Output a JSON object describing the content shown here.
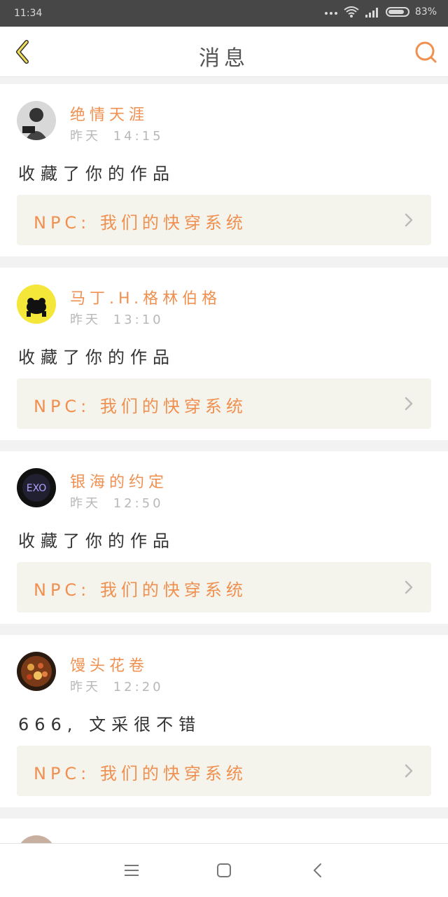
{
  "status_bar": {
    "time": "11:34",
    "battery": "83%",
    "battery_level": 0.83,
    "icons": [
      "more-dots-icon",
      "wifi-icon",
      "signal-icon",
      "battery-icon"
    ]
  },
  "app_bar": {
    "title": "消息",
    "back_icon": "back-chevron-icon",
    "search_icon": "search-icon"
  },
  "colors": {
    "accent": "#f09050",
    "card_bg": "#ffffff",
    "work_bg": "#f4f4ed",
    "page_bg": "#f2f2f2"
  },
  "messages": [
    {
      "user": "绝情天涯",
      "day": "昨天",
      "time": "14:15",
      "text": "收藏了你的作品",
      "work": "NPC: 我们的快穿系统",
      "avatar": "avatar-photo-1"
    },
    {
      "user": "马丁.H.格林伯格",
      "day": "昨天",
      "time": "13:10",
      "text": "收藏了你的作品",
      "work": "NPC: 我们的快穿系统",
      "avatar": "avatar-yellow-bear"
    },
    {
      "user": "银海的约定",
      "day": "昨天",
      "time": "12:50",
      "text": "收藏了你的作品",
      "work": "NPC: 我们的快穿系统",
      "avatar": "avatar-exo"
    },
    {
      "user": "馒头花卷",
      "day": "昨天",
      "time": "12:20",
      "text": "666, 文采很不错",
      "work": "NPC: 我们的快穿系统",
      "avatar": "avatar-lantern"
    }
  ],
  "nav": {
    "icons": [
      "menu-icon",
      "home-square-icon",
      "back-icon"
    ]
  }
}
